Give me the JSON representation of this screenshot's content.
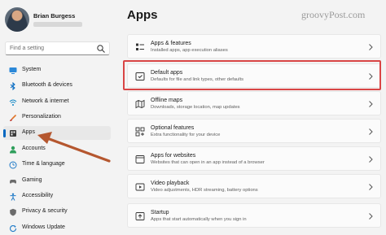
{
  "user": {
    "name": "Brian Burgess"
  },
  "search": {
    "placeholder": "Find a setting"
  },
  "page": {
    "title": "Apps"
  },
  "watermark": "groovyPost.com",
  "sidebar": {
    "items": [
      {
        "label": "System",
        "icon": "monitor-icon"
      },
      {
        "label": "Bluetooth & devices",
        "icon": "bluetooth-icon"
      },
      {
        "label": "Network & internet",
        "icon": "wifi-icon"
      },
      {
        "label": "Personalization",
        "icon": "brush-icon"
      },
      {
        "label": "Apps",
        "icon": "apps-icon",
        "selected": true
      },
      {
        "label": "Accounts",
        "icon": "person-icon"
      },
      {
        "label": "Time & language",
        "icon": "globe-clock-icon"
      },
      {
        "label": "Gaming",
        "icon": "controller-icon"
      },
      {
        "label": "Accessibility",
        "icon": "accessibility-icon"
      },
      {
        "label": "Privacy & security",
        "icon": "shield-icon"
      },
      {
        "label": "Windows Update",
        "icon": "update-icon"
      }
    ]
  },
  "cards": [
    {
      "title": "Apps & features",
      "description": "Installed apps, app execution aliases",
      "icon": "apps-list-icon"
    },
    {
      "title": "Default apps",
      "description": "Defaults for file and link types, other defaults",
      "icon": "default-apps-icon",
      "highlighted": true
    },
    {
      "title": "Offline maps",
      "description": "Downloads, storage location, map updates",
      "icon": "map-icon"
    },
    {
      "title": "Optional features",
      "description": "Extra functionality for your device",
      "icon": "optional-features-icon"
    },
    {
      "title": "Apps for websites",
      "description": "Websites that can open in an app instead of a browser",
      "icon": "link-window-icon"
    },
    {
      "title": "Video playback",
      "description": "Video adjustments, HDR streaming, battery options",
      "icon": "video-icon"
    },
    {
      "title": "Startup",
      "description": "Apps that start automatically when you sign in",
      "icon": "startup-icon"
    }
  ],
  "colors": {
    "accent": "#0067c0",
    "annotation_box": "#d94545",
    "annotation_arrow": "#b5572f"
  }
}
